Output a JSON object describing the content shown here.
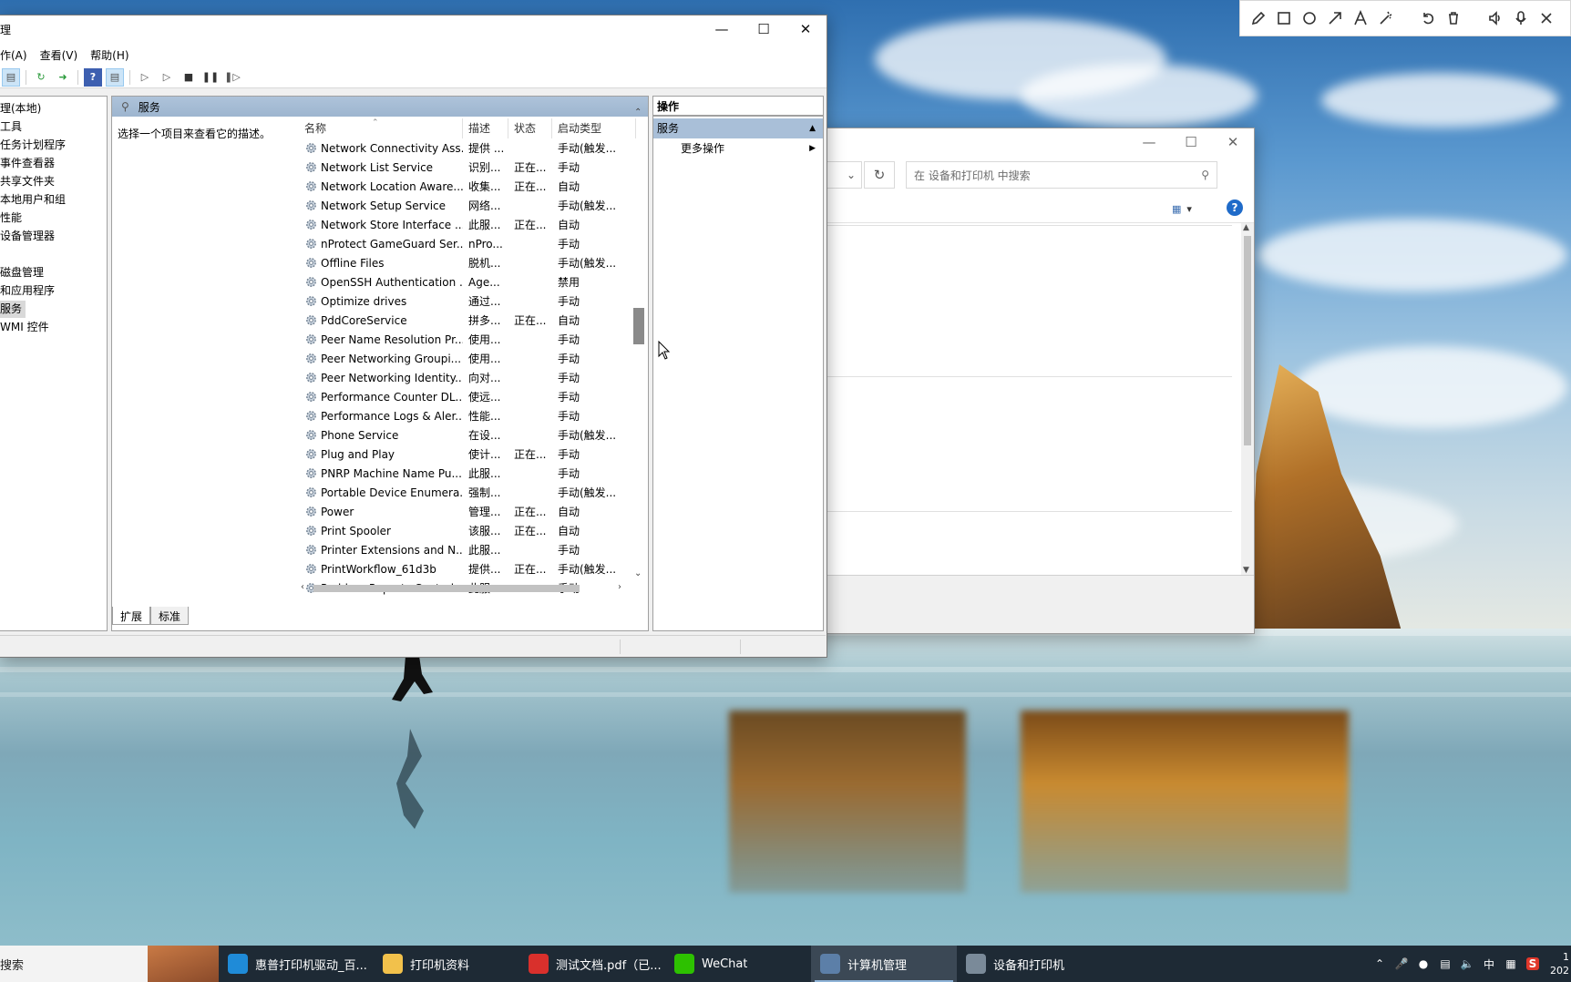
{
  "annotation_toolbar": {
    "tools": [
      "pencil-icon",
      "rectangle-icon",
      "circle-icon",
      "arrow-icon",
      "text-icon",
      "magic-wand-icon",
      "undo-icon",
      "trash-icon",
      "speaker-icon",
      "microphone-icon",
      "close-icon"
    ]
  },
  "devices_window": {
    "search_placeholder": "在 设备和打印机 中搜索",
    "help_label": "?"
  },
  "cm_window": {
    "title": "理",
    "menus": [
      "作(A)",
      "查看(V)",
      "帮助(H)"
    ],
    "tree": [
      {
        "label": "理(本地)"
      },
      {
        "label": "工具"
      },
      {
        "label": "任务计划程序"
      },
      {
        "label": "事件查看器"
      },
      {
        "label": "共享文件夹"
      },
      {
        "label": "本地用户和组"
      },
      {
        "label": "性能"
      },
      {
        "label": "设备管理器"
      },
      {
        "label": ""
      },
      {
        "label": "磁盘管理"
      },
      {
        "label": "和应用程序"
      },
      {
        "label": "服务"
      },
      {
        "label": "WMI 控件"
      }
    ],
    "center_header": "服务",
    "description_prompt": "选择一个项目来查看它的描述。",
    "columns": {
      "name": "名称",
      "desc": "描述",
      "status": "状态",
      "startup": "启动类型"
    },
    "services": [
      {
        "name": "Network Connectivity Ass...",
        "desc": "提供 ...",
        "status": "",
        "startup": "手动(触发..."
      },
      {
        "name": "Network List Service",
        "desc": "识别...",
        "status": "正在...",
        "startup": "手动"
      },
      {
        "name": "Network Location Aware...",
        "desc": "收集...",
        "status": "正在...",
        "startup": "自动"
      },
      {
        "name": "Network Setup Service",
        "desc": "网络...",
        "status": "",
        "startup": "手动(触发..."
      },
      {
        "name": "Network Store Interface ...",
        "desc": "此服...",
        "status": "正在...",
        "startup": "自动"
      },
      {
        "name": "nProtect GameGuard Ser...",
        "desc": "nPro...",
        "status": "",
        "startup": "手动"
      },
      {
        "name": "Offline Files",
        "desc": "脱机...",
        "status": "",
        "startup": "手动(触发..."
      },
      {
        "name": "OpenSSH Authentication ...",
        "desc": "Age...",
        "status": "",
        "startup": "禁用"
      },
      {
        "name": "Optimize drives",
        "desc": "通过...",
        "status": "",
        "startup": "手动"
      },
      {
        "name": "PddCoreService",
        "desc": "拼多...",
        "status": "正在...",
        "startup": "自动"
      },
      {
        "name": "Peer Name Resolution Pr...",
        "desc": "使用...",
        "status": "",
        "startup": "手动"
      },
      {
        "name": "Peer Networking Groupi...",
        "desc": "使用...",
        "status": "",
        "startup": "手动"
      },
      {
        "name": "Peer Networking Identity...",
        "desc": "向对...",
        "status": "",
        "startup": "手动"
      },
      {
        "name": "Performance Counter DL...",
        "desc": "使远...",
        "status": "",
        "startup": "手动"
      },
      {
        "name": "Performance Logs & Aler...",
        "desc": "性能...",
        "status": "",
        "startup": "手动"
      },
      {
        "name": "Phone Service",
        "desc": "在设...",
        "status": "",
        "startup": "手动(触发..."
      },
      {
        "name": "Plug and Play",
        "desc": "使计...",
        "status": "正在...",
        "startup": "手动"
      },
      {
        "name": "PNRP Machine Name Pu...",
        "desc": "此服...",
        "status": "",
        "startup": "手动"
      },
      {
        "name": "Portable Device Enumera...",
        "desc": "强制...",
        "status": "",
        "startup": "手动(触发..."
      },
      {
        "name": "Power",
        "desc": "管理...",
        "status": "正在...",
        "startup": "自动"
      },
      {
        "name": "Print Spooler",
        "desc": "该服...",
        "status": "正在...",
        "startup": "自动"
      },
      {
        "name": "Printer Extensions and N...",
        "desc": "此服...",
        "status": "",
        "startup": "手动"
      },
      {
        "name": "PrintWorkflow_61d3b",
        "desc": "提供...",
        "status": "正在...",
        "startup": "手动(触发..."
      },
      {
        "name": "Problem Reports Control...",
        "desc": "此服...",
        "status": "",
        "startup": "手动"
      }
    ],
    "tabs": [
      "扩展",
      "标准"
    ],
    "actions": {
      "header": "操作",
      "section": "服务",
      "more": "更多操作"
    }
  },
  "taskbar": {
    "search_label": "搜索",
    "tasks": [
      {
        "label": "惠普打印机驱动_百...",
        "icon": "edge-icon",
        "color": "#1f8bd8"
      },
      {
        "label": "打印机资料",
        "icon": "folder-icon",
        "color": "#f2c14b"
      },
      {
        "label": "测试文档.pdf（已...",
        "icon": "wps-icon",
        "color": "#d9302c"
      },
      {
        "label": "WeChat",
        "icon": "wechat-icon",
        "color": "#2dc100"
      },
      {
        "label": "计算机管理",
        "icon": "computer-management-icon",
        "color": "#5c7fa8"
      },
      {
        "label": "设备和打印机",
        "icon": "printer-icon",
        "color": "#7a8a99"
      }
    ],
    "tray": {
      "ime": "中",
      "clock_line1": "1",
      "clock_line2": "202"
    }
  }
}
